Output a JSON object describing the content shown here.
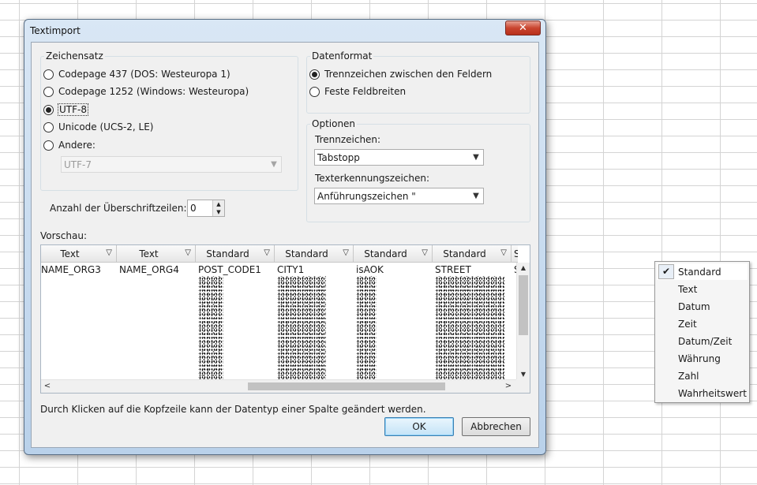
{
  "window": {
    "title": "Textimport",
    "close_icon": "close-icon"
  },
  "zeichensatz": {
    "legend": "Zeichensatz",
    "options": [
      {
        "label": "Codepage 437 (DOS: Westeuropa 1)",
        "checked": false
      },
      {
        "label": "Codepage 1252 (Windows: Westeuropa)",
        "checked": false
      },
      {
        "label": "UTF-8",
        "checked": true
      },
      {
        "label": "Unicode (UCS-2, LE)",
        "checked": false
      },
      {
        "label": "Andere:",
        "checked": false
      }
    ],
    "andere_value": "UTF-7",
    "header_rows_label": "Anzahl der Überschriftzeilen:",
    "header_rows_value": "0"
  },
  "datenformat": {
    "legend": "Datenformat",
    "options": [
      {
        "label": "Trennzeichen zwischen den Feldern",
        "checked": true
      },
      {
        "label": "Feste Feldbreiten",
        "checked": false
      }
    ]
  },
  "optionen": {
    "legend": "Optionen",
    "trennzeichen_label": "Trennzeichen:",
    "trennzeichen_value": "Tabstopp",
    "texterkennung_label": "Texterkennungszeichen:",
    "texterkennung_value": "Anführungszeichen \""
  },
  "preview": {
    "label": "Vorschau:",
    "columns": [
      {
        "type": "Text",
        "first": "NAME_ORG3"
      },
      {
        "type": "Text",
        "first": "NAME_ORG4"
      },
      {
        "type": "Standard",
        "first": "POST_CODE1"
      },
      {
        "type": "Standard",
        "first": "CITY1"
      },
      {
        "type": "Standard",
        "first": "isAOK"
      },
      {
        "type": "Standard",
        "first": "STREET"
      },
      {
        "type": "S",
        "first": "S"
      }
    ]
  },
  "hint": "Durch Klicken auf die Kopfzeile kann der Datentyp einer Spalte geändert werden.",
  "buttons": {
    "ok": "OK",
    "cancel": "Abbrechen"
  },
  "context_menu": {
    "items": [
      {
        "label": "Standard",
        "checked": true
      },
      {
        "label": "Text",
        "checked": false
      },
      {
        "label": "Datum",
        "checked": false
      },
      {
        "label": "Zeit",
        "checked": false
      },
      {
        "label": "Datum/Zeit",
        "checked": false
      },
      {
        "label": "Währung",
        "checked": false
      },
      {
        "label": "Zahl",
        "checked": false
      },
      {
        "label": "Wahrheitswert",
        "checked": false
      }
    ]
  }
}
